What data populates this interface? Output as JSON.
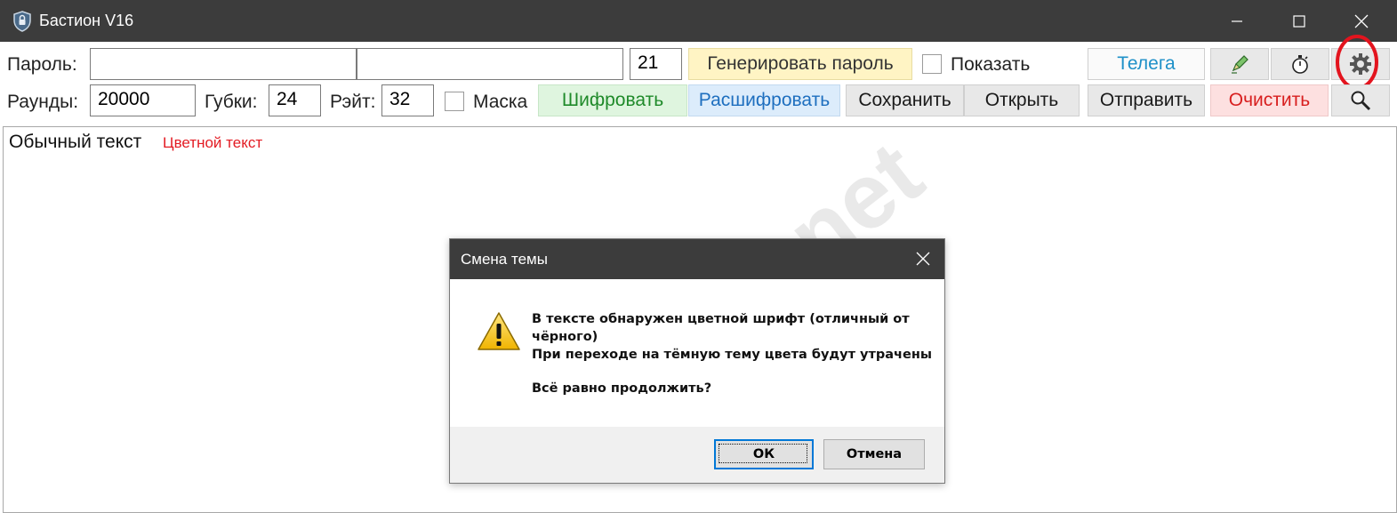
{
  "window": {
    "title": "Бастион V16",
    "icon": "shield-lock-icon"
  },
  "toolbar1": {
    "password_label": "Пароль:",
    "password_value_1": "",
    "password_value_2": "",
    "length_value": "21",
    "generate_label": "Генерировать пароль",
    "show_label": "Показать",
    "telega_label": "Телега",
    "icons": [
      "pen-icon",
      "stopwatch-icon",
      "gear-icon"
    ]
  },
  "toolbar2": {
    "rounds_label": "Раунды:",
    "rounds_value": "20000",
    "sponge_label": "Губки:",
    "sponge_value": "24",
    "rate_label": "Рэйт:",
    "rate_value": "32",
    "mask_label": "Маска",
    "encrypt_label": "Шифровать",
    "decrypt_label": "Расшифровать",
    "save_label": "Сохранить",
    "open_label": "Открыть",
    "send_label": "Отправить",
    "clear_label": "Очистить",
    "search_icon": "magnifier-icon"
  },
  "editor": {
    "plain_text": "Обычный текст",
    "colored_text": "Цветной текст",
    "colored_color": "#e31b23"
  },
  "watermark": "codeby.net",
  "dialog": {
    "title": "Смена темы",
    "icon": "warning-icon",
    "line1": "В тексте обнаружен цветной шрифт (отличный от",
    "line2": "чёрного)",
    "line3": "При переходе на тёмную тему цвета будут утрачены",
    "line4": "Всё равно продолжить?",
    "ok_label": "ОК",
    "cancel_label": "Отмена"
  },
  "colors": {
    "titlebar": "#3c3c3c",
    "generate_bg": "#fff4c4",
    "encrypt_bg": "#dff5df",
    "decrypt_bg": "#dcecfb",
    "clear_bg": "#fde0e0",
    "highlight_circle": "#e3141e"
  }
}
